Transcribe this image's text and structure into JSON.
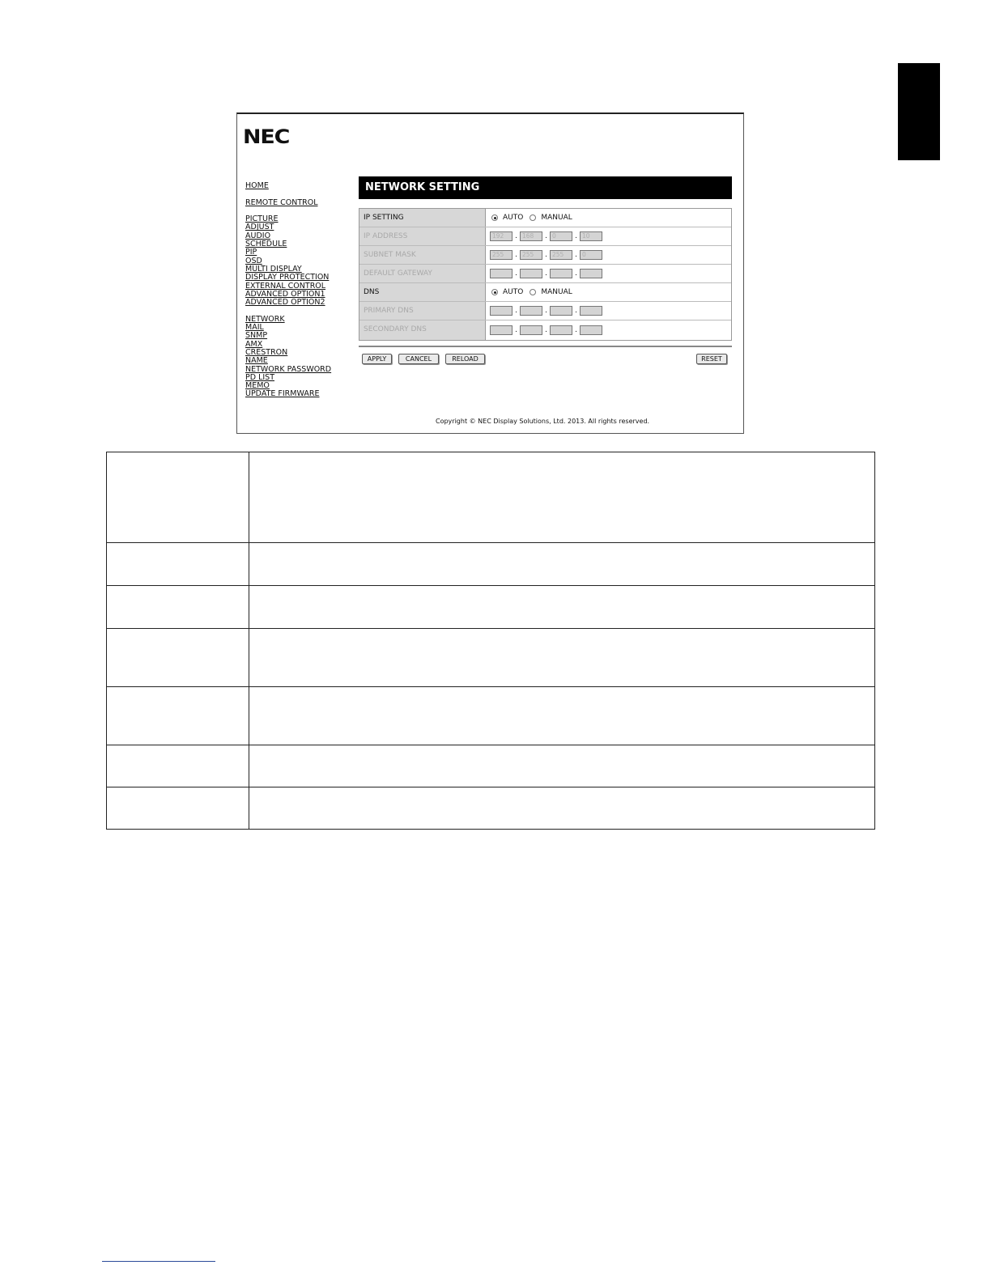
{
  "logo": "NEC",
  "nav": {
    "group1": [
      "HOME"
    ],
    "group2": [
      "REMOTE CONTROL"
    ],
    "group3": [
      "PICTURE",
      "ADJUST",
      "AUDIO",
      "SCHEDULE",
      "PIP",
      "OSD",
      "MULTI DISPLAY",
      "DISPLAY PROTECTION",
      "EXTERNAL CONTROL",
      "ADVANCED OPTION1",
      "ADVANCED OPTION2"
    ],
    "group4": [
      "NETWORK",
      "MAIL",
      "SNMP",
      "AMX",
      "CRESTRON",
      "NAME",
      "NETWORK PASSWORD",
      "PD LIST",
      "MEMO",
      "UPDATE FIRMWARE"
    ]
  },
  "panel": {
    "title": "NETWORK SETTING",
    "ip_setting": {
      "label": "IP SETTING",
      "auto": "AUTO",
      "manual": "MANUAL",
      "selected": "AUTO"
    },
    "ip_address": {
      "label": "IP ADDRESS",
      "octets": [
        "192",
        "168",
        "0",
        "10"
      ]
    },
    "subnet_mask": {
      "label": "SUBNET MASK",
      "octets": [
        "255",
        "255",
        "255",
        "0"
      ]
    },
    "default_gateway": {
      "label": "DEFAULT GATEWAY",
      "octets": [
        "",
        "",
        "",
        ""
      ]
    },
    "dns": {
      "label": "DNS",
      "auto": "AUTO",
      "manual": "MANUAL",
      "selected": "AUTO"
    },
    "primary_dns": {
      "label": "PRIMARY DNS",
      "octets": [
        "",
        "",
        "",
        ""
      ]
    },
    "secondary_dns": {
      "label": "SECONDARY DNS",
      "octets": [
        "",
        "",
        "",
        ""
      ]
    },
    "buttons": {
      "apply": "APPLY",
      "cancel": "CANCEL",
      "reload": "RELOAD",
      "reset": "RESET"
    },
    "copyright": "Copyright © NEC Display Solutions, Ltd. 2013. All rights reserved."
  }
}
